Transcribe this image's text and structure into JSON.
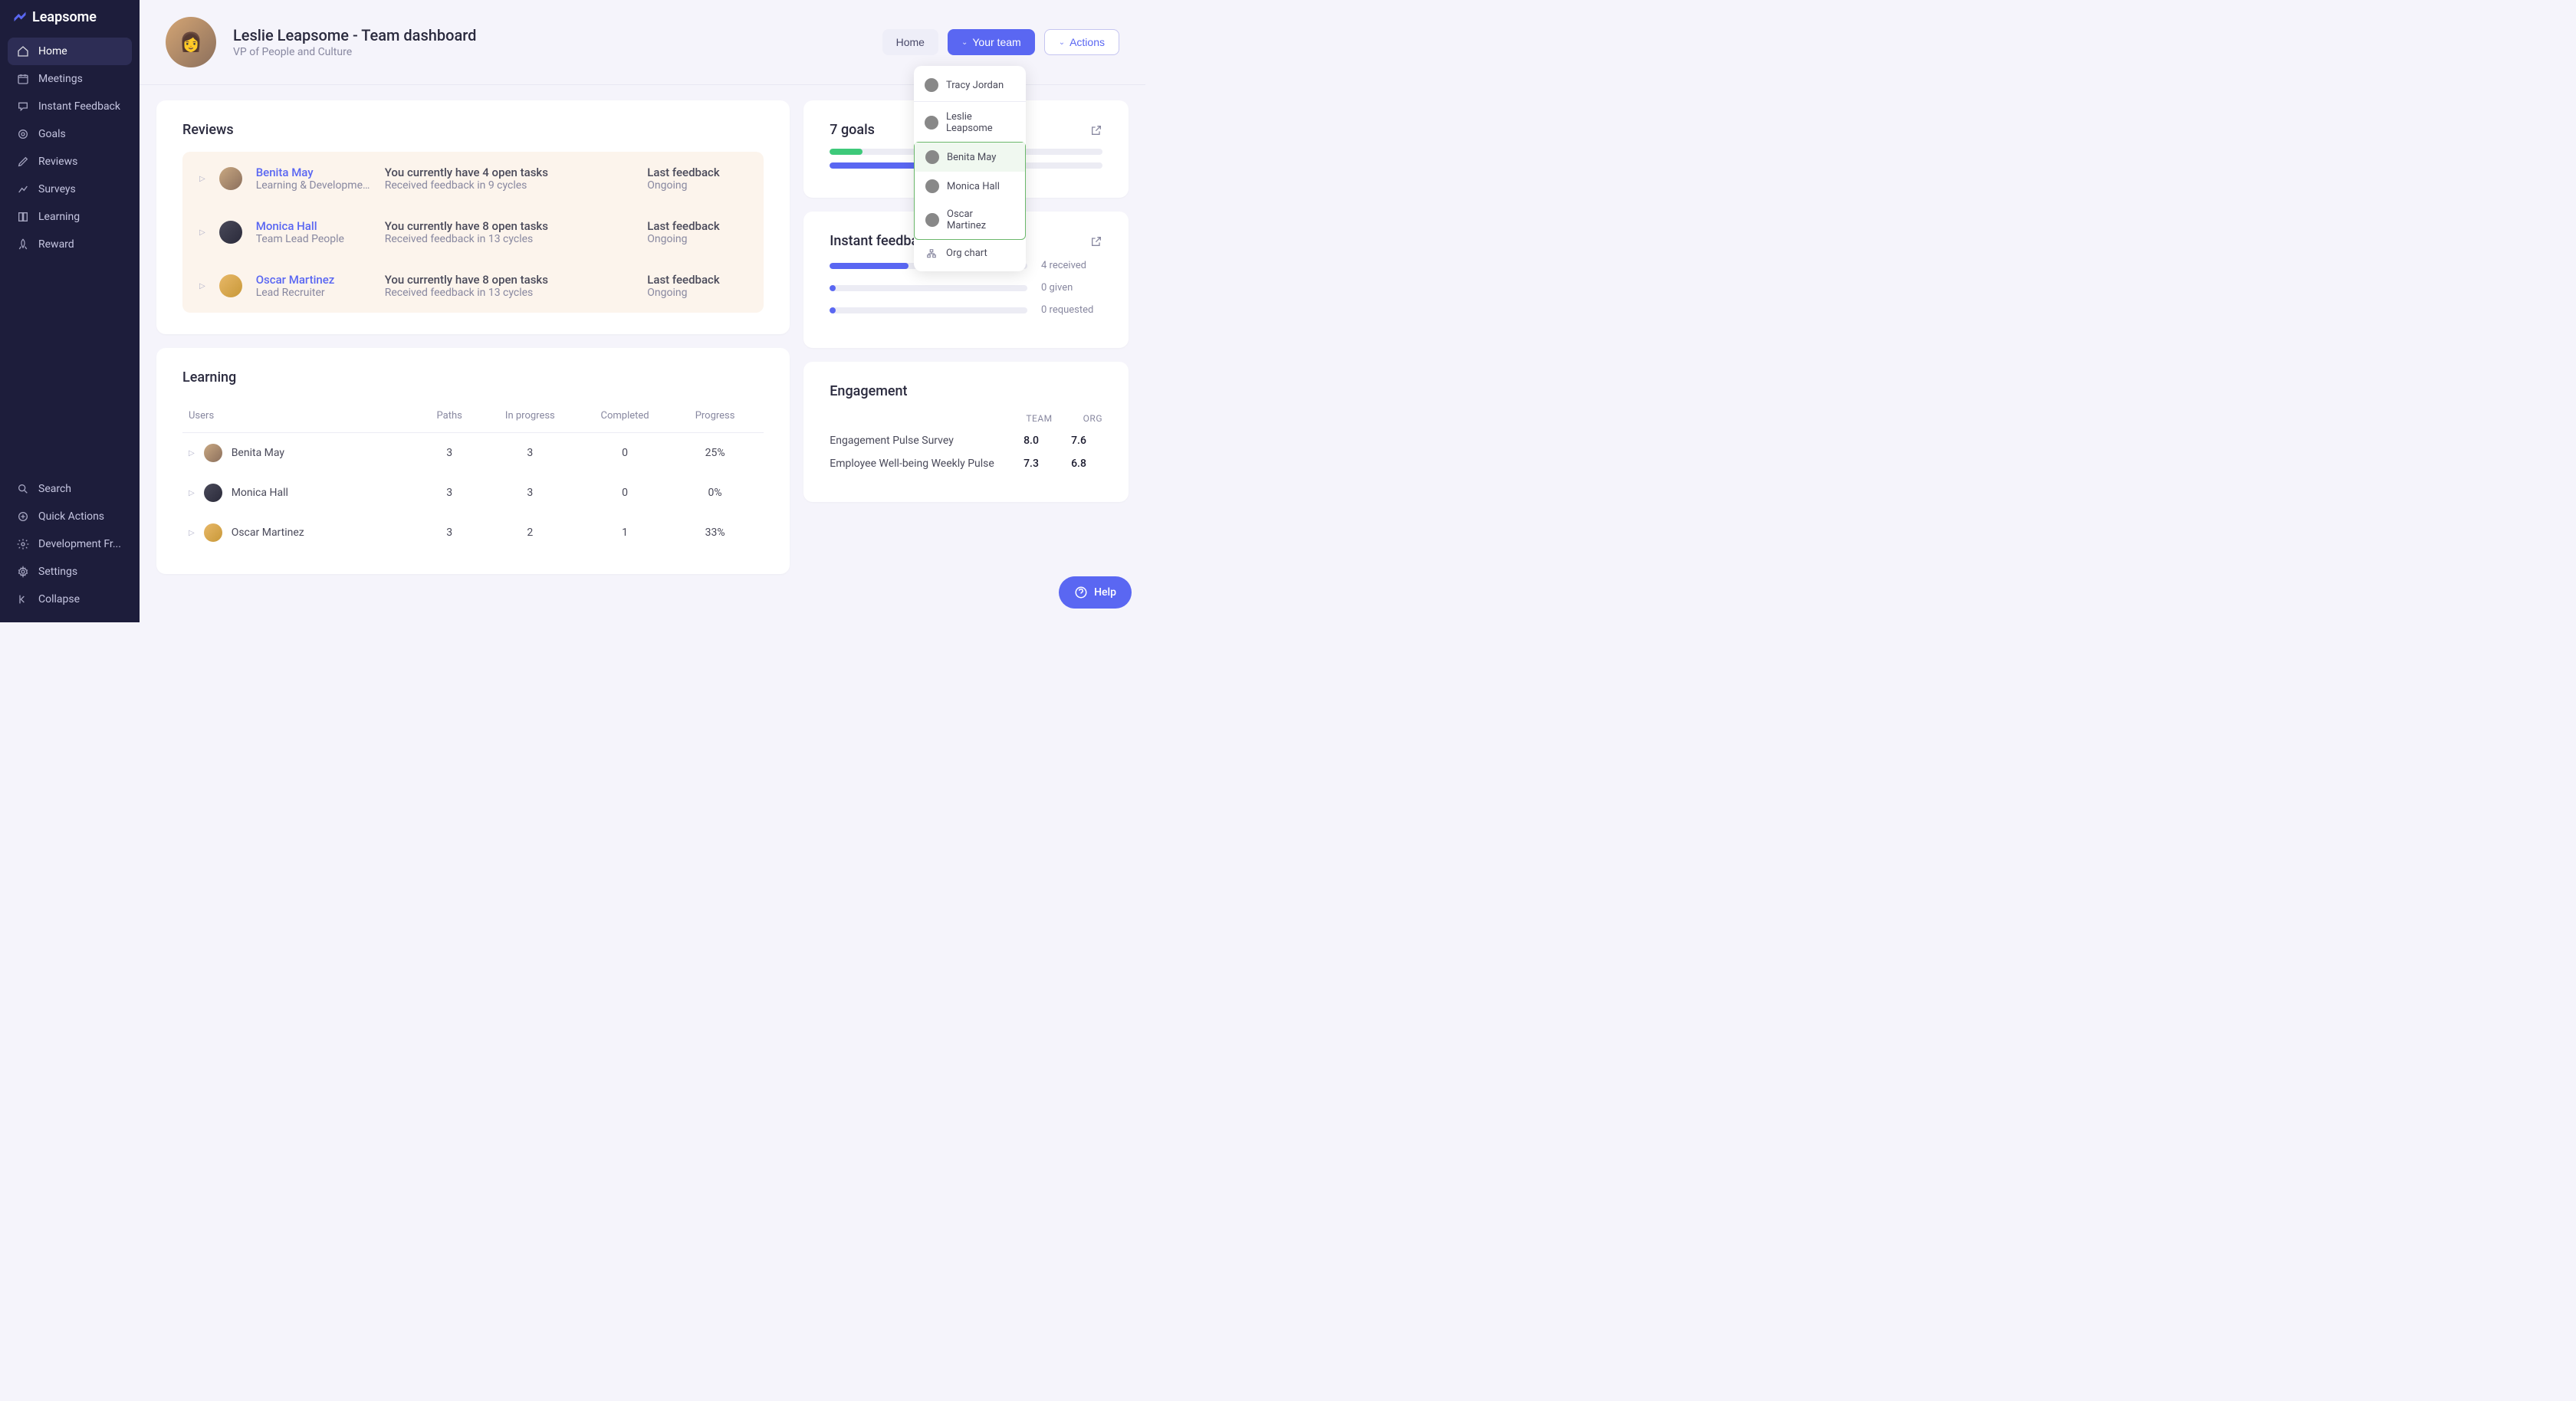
{
  "brand": "Leapsome",
  "sidebar": {
    "items": [
      {
        "label": "Home",
        "icon": "home-icon",
        "active": true
      },
      {
        "label": "Meetings",
        "icon": "calendar-icon"
      },
      {
        "label": "Instant Feedback",
        "icon": "feedback-icon"
      },
      {
        "label": "Goals",
        "icon": "target-icon"
      },
      {
        "label": "Reviews",
        "icon": "edit-icon"
      },
      {
        "label": "Surveys",
        "icon": "chart-icon"
      },
      {
        "label": "Learning",
        "icon": "book-icon"
      },
      {
        "label": "Reward",
        "icon": "rocket-icon"
      }
    ],
    "bottom": [
      {
        "label": "Search",
        "icon": "search-icon"
      },
      {
        "label": "Quick Actions",
        "icon": "plus-icon"
      },
      {
        "label": "Development Fr...",
        "icon": "gear-icon"
      },
      {
        "label": "Settings",
        "icon": "settings-icon"
      },
      {
        "label": "Collapse",
        "icon": "collapse-icon"
      }
    ]
  },
  "header": {
    "title": "Leslie Leapsome - Team dashboard",
    "subtitle": "VP of People and Culture",
    "buttons": {
      "home": "Home",
      "team": "Your team",
      "actions": "Actions"
    }
  },
  "dropdown": {
    "top": [
      {
        "name": "Tracy Jordan"
      },
      {
        "name": "Leslie Leapsome"
      }
    ],
    "group": [
      {
        "name": "Benita May",
        "active": true
      },
      {
        "name": "Monica Hall"
      },
      {
        "name": "Oscar Martinez"
      }
    ],
    "org": "Org chart"
  },
  "reviews": {
    "title": "Reviews",
    "rows": [
      {
        "name": "Benita May",
        "role": "Learning & Developmen...",
        "tasks": "You currently have 4 open tasks",
        "feedback": "Received feedback in 9 cycles",
        "status_label": "Last feedback",
        "status": "Ongoing"
      },
      {
        "name": "Monica Hall",
        "role": "Team Lead People",
        "tasks": "You currently have 8 open tasks",
        "feedback": "Received feedback in 13 cycles",
        "status_label": "Last feedback",
        "status": "Ongoing"
      },
      {
        "name": "Oscar Martinez",
        "role": "Lead Recruiter",
        "tasks": "You currently have 8 open tasks",
        "feedback": "Received feedback in 13 cycles",
        "status_label": "Last feedback",
        "status": "Ongoing"
      }
    ]
  },
  "learning": {
    "title": "Learning",
    "columns": {
      "users": "Users",
      "paths": "Paths",
      "in_progress": "In progress",
      "completed": "Completed",
      "progress": "Progress"
    },
    "rows": [
      {
        "name": "Benita May",
        "paths": "3",
        "in_progress": "3",
        "completed": "0",
        "progress": "25%"
      },
      {
        "name": "Monica Hall",
        "paths": "3",
        "in_progress": "3",
        "completed": "0",
        "progress": "0%"
      },
      {
        "name": "Oscar Martinez",
        "paths": "3",
        "in_progress": "2",
        "completed": "1",
        "progress": "33%"
      }
    ]
  },
  "goals": {
    "title": "7 goals",
    "bars": [
      {
        "color": "green",
        "pct": 12
      },
      {
        "color": "blue",
        "pct": 52
      }
    ]
  },
  "instant_feedback": {
    "title": "Instant feedback (last 30 days)",
    "rows": [
      {
        "pct": 40,
        "label": "4 received"
      },
      {
        "pct": 3,
        "label": "0 given"
      },
      {
        "pct": 3,
        "label": "0 requested"
      }
    ]
  },
  "engagement": {
    "title": "Engagement",
    "col_team": "TEAM",
    "col_org": "ORG",
    "rows": [
      {
        "label": "Engagement Pulse Survey",
        "team": "8.0",
        "org": "7.6"
      },
      {
        "label": "Employee Well-being Weekly Pulse",
        "team": "7.3",
        "org": "6.8"
      }
    ]
  },
  "help": "Help"
}
